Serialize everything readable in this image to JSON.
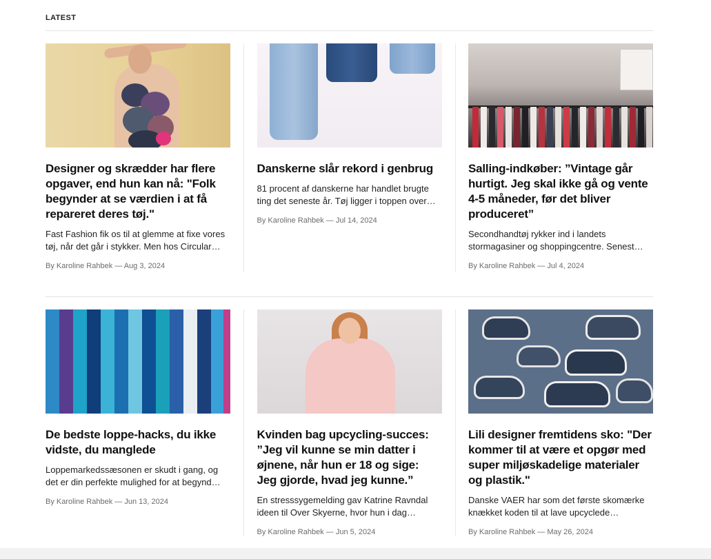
{
  "section": {
    "title": "LATEST"
  },
  "articles": [
    {
      "headline": "Designer og skrædder har flere opgaver, end hun kan nå: \"Folk begynder at se værdien i at få repareret deres tøj.\"",
      "excerpt": "Fast Fashion fik os til at glemme at fixe vores tøj, når det går i stykker. Men hos Circular…",
      "meta": "By Karoline Rahbek — Aug 3, 2024",
      "image": "woman-with-fabric-ruffle-top"
    },
    {
      "headline": "Danskerne slår rekord i genbrug",
      "excerpt": "81 procent af danskerne har handlet brugte ting det seneste år. Tøj ligger i toppen over…",
      "meta": "By Karoline Rahbek — Jul 14, 2024",
      "image": "hanging-jeans"
    },
    {
      "headline": "Salling-indkøber: ”Vintage går hurtigt. Jeg skal ikke gå og vente 4-5 måneder, før det bliver produceret”",
      "excerpt": "Secondhandtøj rykker ind i landets stormagasiner og shoppingcentre. Senest…",
      "meta": "By Karoline Rahbek — Jul 4, 2024",
      "image": "department-store-clothing-rack"
    },
    {
      "headline": "De bedste loppe-hacks, du ikke vidste, du manglede",
      "excerpt": "Loppemarkedssæsonen er skudt i gang, og det er din perfekte mulighed for at begynd…",
      "meta": "By Karoline Rahbek — Jun 13, 2024",
      "image": "colorful-blue-dresses-on-rack"
    },
    {
      "headline": "Kvinden bag upcycling-succes: ”Jeg vil kunne se min datter i øjnene, når hun er 18 og sige: Jeg gjorde, hvad jeg kunne.”",
      "excerpt": "En stresssygemelding gav Katrine Ravndal ideen til Over Skyerne, hvor hun i dag…",
      "meta": "By Karoline Rahbek — Jun 5, 2024",
      "image": "woman-in-pink-lace-outfit"
    },
    {
      "headline": "Lili designer fremtidens sko: \"Der kommer til at være et opgør med super miljøskadelige materialer og plastik.\"",
      "excerpt": "Danske VAER har som det første skomærke knækket koden til at lave upcyclede…",
      "meta": "By Karoline Rahbek — May 26, 2024",
      "image": "denim-sneakers-pile"
    }
  ]
}
